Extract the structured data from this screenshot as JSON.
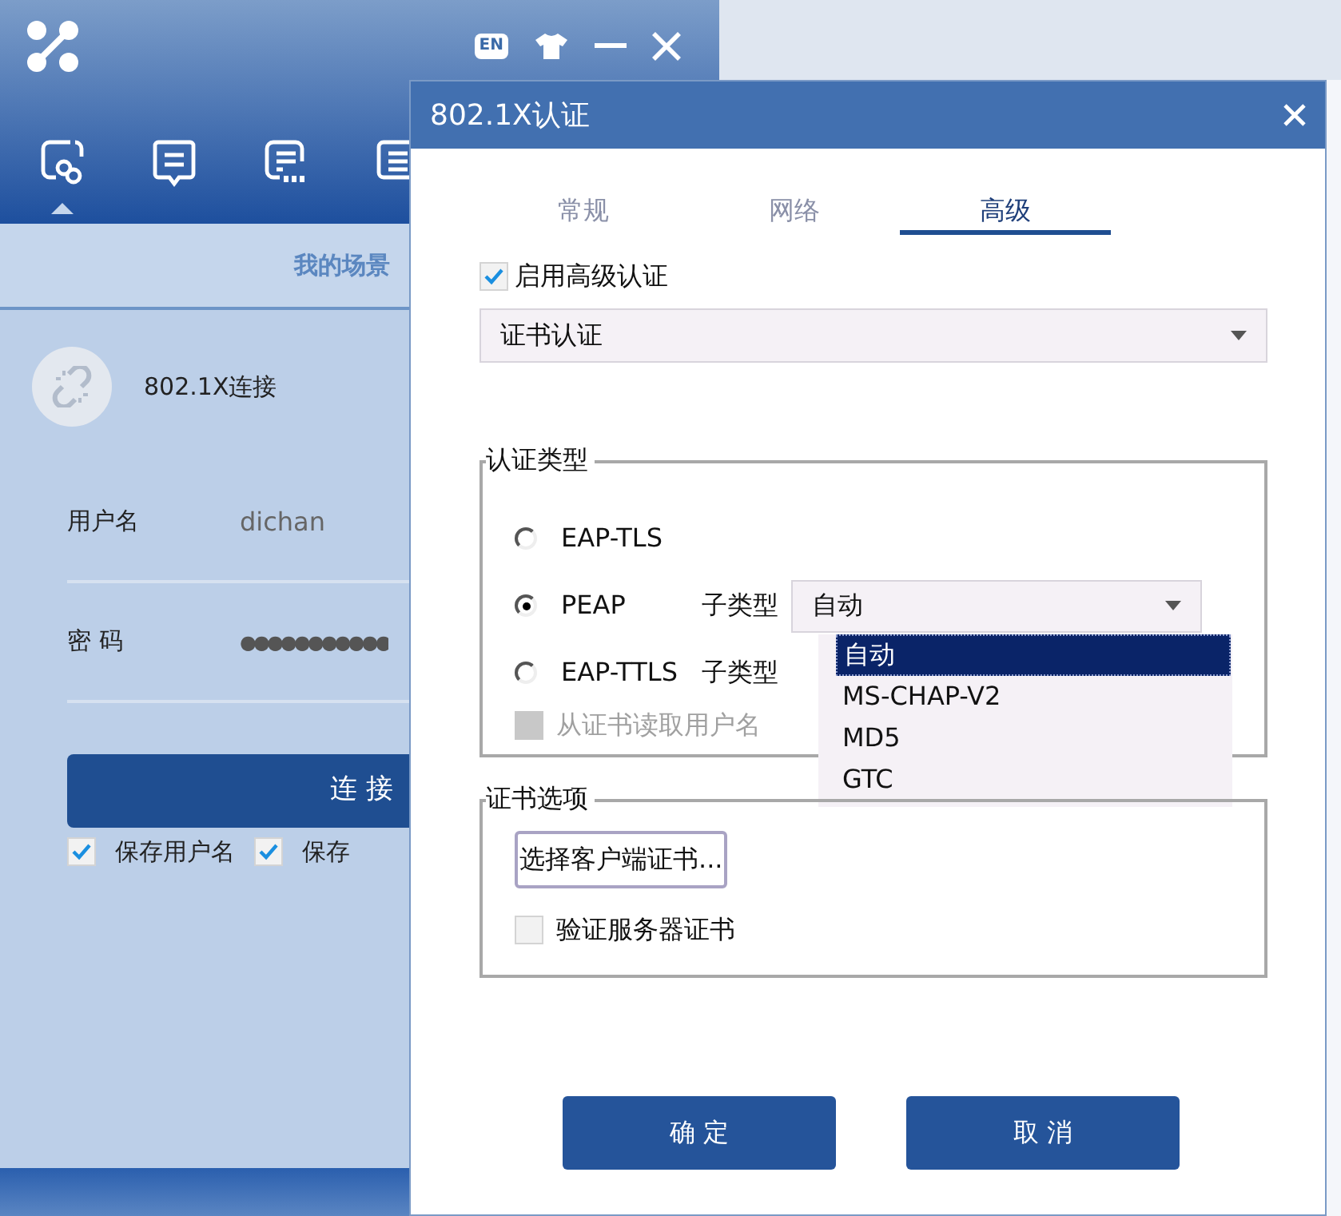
{
  "main_window": {
    "lang_button": "EN",
    "nav": [
      {
        "kind": "link",
        "selected": true
      },
      {
        "kind": "message",
        "selected": false
      },
      {
        "kind": "list",
        "selected": false
      },
      {
        "kind": "doc",
        "selected": false
      }
    ],
    "section_title": "我的场景",
    "connection": {
      "name": "802.1X连接"
    },
    "fields": [
      {
        "label": "用户名",
        "value": "dichan",
        "kind": "text"
      },
      {
        "label": "密 码",
        "value": "●●●●●●●●●●●",
        "kind": "password"
      }
    ],
    "connect_button": "连 接",
    "options": [
      {
        "label": "保存用户名",
        "checked": true
      },
      {
        "label": "保存",
        "checked": true
      }
    ]
  },
  "dialog": {
    "title": "802.1X认证",
    "tabs": [
      {
        "label": "常规",
        "selected": false
      },
      {
        "label": "网络",
        "selected": false
      },
      {
        "label": "高级",
        "selected": true
      }
    ],
    "enable_advanced": {
      "label": "启用高级认证",
      "checked": true
    },
    "auth_method": "证书认证",
    "auth_type": {
      "legend": "认证类型",
      "methods": [
        {
          "label": "EAP-TLS",
          "selected": false
        },
        {
          "label": "PEAP",
          "selected": true,
          "subtype_label": "子类型",
          "subtype_value": "自动"
        },
        {
          "label": "EAP-TTLS",
          "selected": false,
          "subtype_label": "子类型"
        }
      ],
      "read_user": {
        "label": "从证书读取用户名",
        "checked": false,
        "disabled": true
      }
    },
    "subtype_options": [
      {
        "label": "自动",
        "selected": true
      },
      {
        "label": "MS-CHAP-V2",
        "selected": false
      },
      {
        "label": "MD5",
        "selected": false
      },
      {
        "label": "GTC",
        "selected": false
      }
    ],
    "cert_options": {
      "legend": "证书选项",
      "choose_button": "选择客户端证书...",
      "verify": {
        "label": "验证服务器证书",
        "checked": false,
        "disabled": false
      }
    },
    "buttons": [
      "确 定",
      "取 消"
    ]
  }
}
